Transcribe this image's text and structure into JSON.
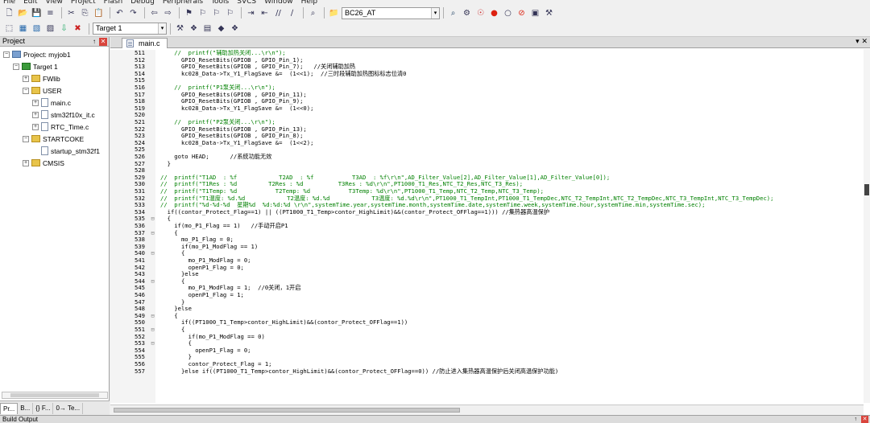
{
  "menu": [
    "File",
    "Edit",
    "View",
    "Project",
    "Flash",
    "Debug",
    "Peripherals",
    "Tools",
    "SVCS",
    "Window",
    "Help"
  ],
  "toolbar": {
    "row1_icons": [
      "new-file",
      "open-file",
      "save",
      "save-all",
      "cut",
      "copy",
      "paste",
      "undo",
      "redo",
      "nav-back",
      "nav-forward",
      "bookmark-set",
      "bookmark-prev",
      "bookmark-next",
      "bookmark-clear",
      "indent",
      "unindent",
      "comment",
      "uncomment",
      "find-in-files"
    ],
    "project_combo": "BC26_AT",
    "row1_right_icons": [
      "find",
      "configure",
      "debug",
      "breakpoint-insert",
      "breakpoint-disable",
      "breakpoint-kill",
      "windows",
      "tools"
    ],
    "row2_icons": [
      "translate",
      "build",
      "rebuild",
      "batch-build",
      "download",
      "stop-build"
    ],
    "target_combo": "Target 1",
    "row2_right_icons": [
      "options-for-target",
      "manage-components",
      "pack-installer",
      "select-device",
      "manage-project-items"
    ]
  },
  "project_pane": {
    "title": "Project",
    "tree": [
      {
        "label": "Project: myjob1",
        "indent": 0,
        "type": "project",
        "expander": "minus"
      },
      {
        "label": "Target 1",
        "indent": 1,
        "type": "target",
        "expander": "minus"
      },
      {
        "label": "FWlib",
        "indent": 2,
        "type": "folder",
        "expander": "plus"
      },
      {
        "label": "USER",
        "indent": 2,
        "type": "folder",
        "expander": "minus"
      },
      {
        "label": "main.c",
        "indent": 3,
        "type": "file",
        "expander": "plus"
      },
      {
        "label": "stm32f10x_it.c",
        "indent": 3,
        "type": "file",
        "expander": "plus"
      },
      {
        "label": "RTC_Time.c",
        "indent": 3,
        "type": "file",
        "expander": "plus"
      },
      {
        "label": "STARTCOKE",
        "indent": 2,
        "type": "folder",
        "expander": "minus"
      },
      {
        "label": "startup_stm32f1",
        "indent": 3,
        "type": "file",
        "expander": "none"
      },
      {
        "label": "CMSIS",
        "indent": 2,
        "type": "folder",
        "expander": "plus"
      }
    ],
    "tabs": [
      "Pr...",
      "B...",
      "{} F...",
      "0→ Te..."
    ]
  },
  "editor": {
    "tab_label": "main.c",
    "lines": [
      {
        "n": "511",
        "f": "",
        "t": "    //  printf(\"辅助加热关闭...\\r\\n\");"
      },
      {
        "n": "512",
        "f": "",
        "t": "      GPIO_ResetBits(GPIOB , GPIO_Pin_1);"
      },
      {
        "n": "513",
        "f": "",
        "t": "      GPIO_ResetBits(GPIOB , GPIO_Pin_7);   //关闭辅助加热"
      },
      {
        "n": "514",
        "f": "",
        "t": "      kc028_Data->Tx_Y1_FlagSave &=  (1<<1);  //三时段辅助加热图标标志位清0"
      },
      {
        "n": "515",
        "f": "",
        "t": ""
      },
      {
        "n": "516",
        "f": "",
        "t": "    //  printf(\"P1泵关闭...\\r\\n\");"
      },
      {
        "n": "517",
        "f": "",
        "t": "      GPIO_ResetBits(GPIOB , GPIO_Pin_11);"
      },
      {
        "n": "518",
        "f": "",
        "t": "      GPIO_ResetBits(GPIOB , GPIO_Pin_9);"
      },
      {
        "n": "519",
        "f": "",
        "t": "      kc028_Data->Tx_Y1_FlagSave &=  (1<<0);"
      },
      {
        "n": "520",
        "f": "",
        "t": ""
      },
      {
        "n": "521",
        "f": "",
        "t": "    //  printf(\"P2泵关闭...\\r\\n\");"
      },
      {
        "n": "522",
        "f": "",
        "t": "      GPIO_ResetBits(GPIOB , GPIO_Pin_13);"
      },
      {
        "n": "523",
        "f": "",
        "t": "      GPIO_ResetBits(GPIOB , GPIO_Pin_8);"
      },
      {
        "n": "524",
        "f": "",
        "t": "      kc028_Data->Tx_Y1_FlagSave &=  (1<<2);"
      },
      {
        "n": "525",
        "f": "",
        "t": ""
      },
      {
        "n": "526",
        "f": "",
        "t": "    goto HEAD;      //系统功能无效"
      },
      {
        "n": "527",
        "f": "",
        "t": "  }"
      },
      {
        "n": "528",
        "f": "",
        "t": ""
      },
      {
        "n": "529",
        "f": "",
        "t": "//  printf(\"T1AD  : %f            T2AD  : %f           T3AD  : %f\\r\\n\",AD_Filter_Value[2],AD_Filter_Value[1],AD_Filter_Value[0]);"
      },
      {
        "n": "530",
        "f": "",
        "t": "//  printf(\"T1Res : %d         T2Res : %d          T3Res : %d\\r\\n\",PT1000_T1_Res,NTC_T2_Res,NTC_T3_Res);"
      },
      {
        "n": "531",
        "f": "",
        "t": "//  printf(\"T1Temp: %d           T2Temp: %d           T3Temp: %d\\r\\n\",PT1000_T1_Temp,NTC_T2_Temp,NTC_T3_Temp);"
      },
      {
        "n": "532",
        "f": "",
        "t": "//  printf(\"T1温度: %d.%d            T2温度: %d.%d            T3温度: %d.%d\\r\\n\",PT1000_T1_TempInt,PT1000_T1_TempDec,NTC_T2_TempInt,NTC_T2_TempDec,NTC_T3_TempInt,NTC_T3_TempDec);"
      },
      {
        "n": "533",
        "f": "",
        "t": "//  printf(\"%d-%d-%d  星期%d  %d:%d:%d \\r\\n\",systemTime.year,systemTime.month,systemTime.date,systemTime.week,systemTime.hour,systemTime.min,systemTime.sec);"
      },
      {
        "n": "534",
        "f": "",
        "t": "  if((contor_Protect_Flag==1) || ((PT1000_T1_Temp>contor_HighLimit)&&(contor_Protect_OFFlag==1))) //集热器高温保护"
      },
      {
        "n": "535",
        "f": "⊟",
        "t": "  {"
      },
      {
        "n": "536",
        "f": "",
        "t": "    if(mo_P1_Flag == 1)   //手动开启P1"
      },
      {
        "n": "537",
        "f": "⊟",
        "t": "    {"
      },
      {
        "n": "538",
        "f": "",
        "t": "      mo_P1_Flag = 0;"
      },
      {
        "n": "539",
        "f": "",
        "t": "      if(mo_P1_ModFlag == 1)"
      },
      {
        "n": "540",
        "f": "⊟",
        "t": "      {"
      },
      {
        "n": "541",
        "f": "",
        "t": "        mo_P1_ModFlag = 0;"
      },
      {
        "n": "542",
        "f": "",
        "t": "        openP1_Flag = 0;"
      },
      {
        "n": "543",
        "f": "",
        "t": "      }else"
      },
      {
        "n": "544",
        "f": "⊟",
        "t": "      {"
      },
      {
        "n": "545",
        "f": "",
        "t": "        mo_P1_ModFlag = 1;  //0关闭，1开启"
      },
      {
        "n": "546",
        "f": "",
        "t": "        openP1_Flag = 1;"
      },
      {
        "n": "547",
        "f": "",
        "t": "      }"
      },
      {
        "n": "548",
        "f": "",
        "t": "    }else"
      },
      {
        "n": "549",
        "f": "⊟",
        "t": "    {"
      },
      {
        "n": "550",
        "f": "",
        "t": "      if((PT1000_T1_Temp>contor_HighLimit)&&(contor_Protect_OFFlag==1))"
      },
      {
        "n": "551",
        "f": "⊟",
        "t": "      {"
      },
      {
        "n": "552",
        "f": "",
        "t": "        if(mo_P1_ModFlag == 0)"
      },
      {
        "n": "553",
        "f": "⊟",
        "t": "        {"
      },
      {
        "n": "554",
        "f": "",
        "t": "          openP1_Flag = 0;"
      },
      {
        "n": "555",
        "f": "",
        "t": "        }"
      },
      {
        "n": "556",
        "f": "",
        "t": "        contor_Protect_Flag = 1;"
      },
      {
        "n": "557",
        "f": "",
        "t": "      }else if((PT1000_T1_Temp>contor_HighLimit)&&(contor_Protect_OFFlag==0)) //防止进入集热器高温保护后关闭高温保护功能)"
      }
    ]
  },
  "build_output": {
    "title": "Build Output"
  }
}
